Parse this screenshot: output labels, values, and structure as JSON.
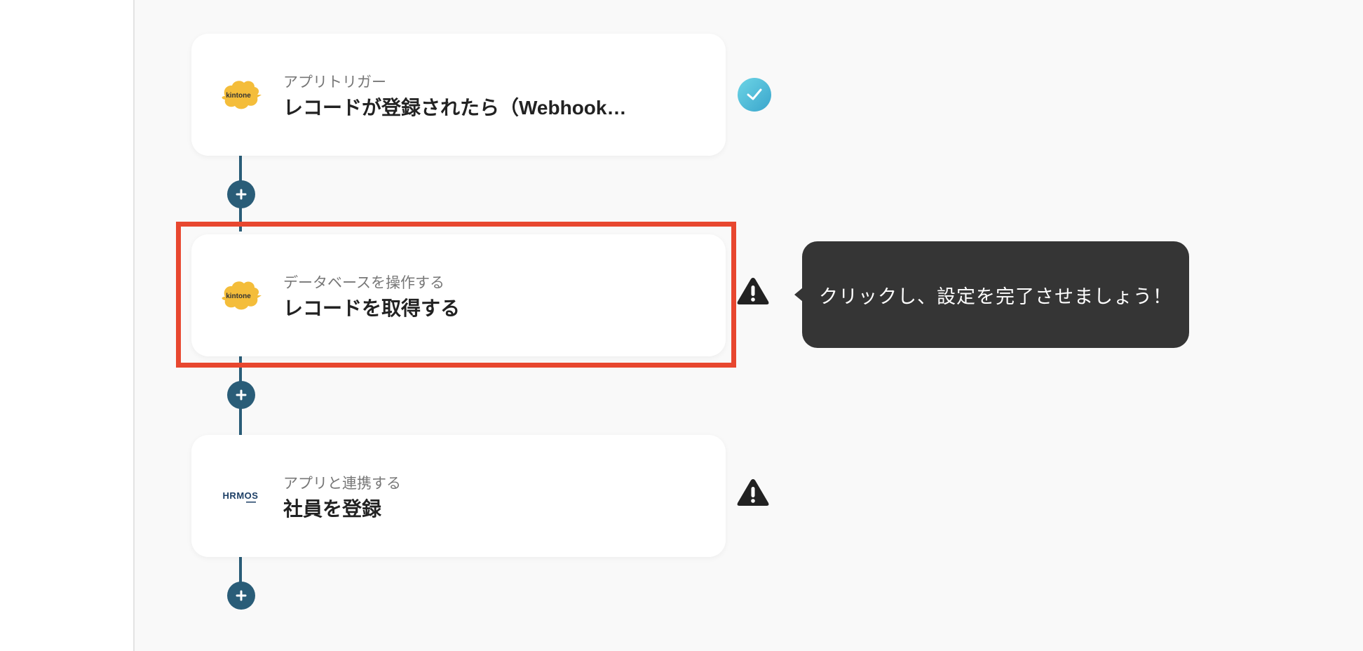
{
  "steps": [
    {
      "subtitle": "アプリトリガー",
      "title": "レコードが登録されたら（Webhook…",
      "app_logo": "kintone",
      "status": "complete"
    },
    {
      "subtitle": "データベースを操作する",
      "title": "レコードを取得する",
      "app_logo": "kintone",
      "status": "warning"
    },
    {
      "subtitle": "アプリと連携する",
      "title": "社員を登録",
      "app_logo": "HRMOS",
      "status": "warning"
    }
  ],
  "tooltip": {
    "text": "クリックし、設定を完了させましょう！"
  },
  "icons": {
    "add": "plus-icon",
    "complete": "check-icon",
    "warning": "warning-icon"
  },
  "colors": {
    "connector": "#2a5d78",
    "highlight": "#e8472f",
    "check_gradient_start": "#6dd5e6",
    "check_gradient_end": "#3aa5cc",
    "tooltip_bg": "#353535",
    "kintone_yellow": "#f4bd3a",
    "hrmos_navy": "#1d3f66"
  }
}
